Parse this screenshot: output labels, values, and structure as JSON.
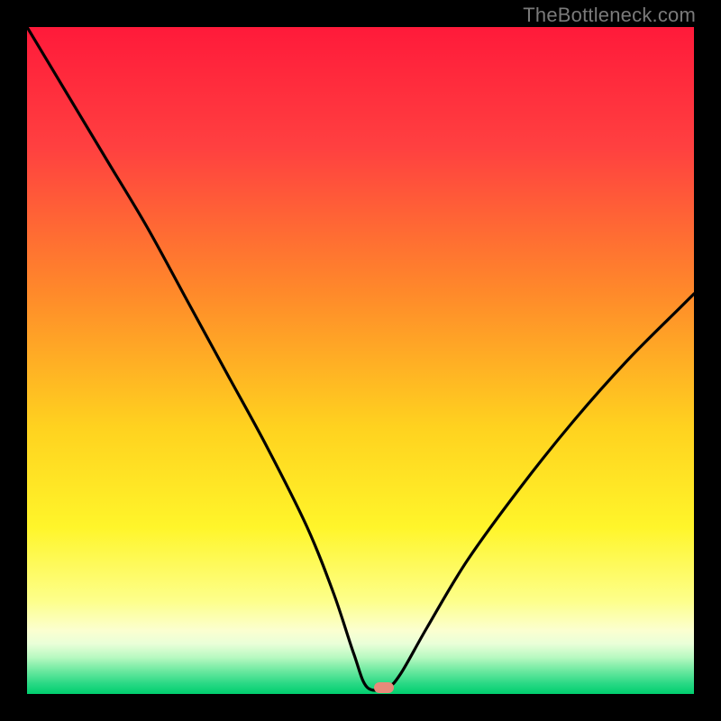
{
  "watermark": "TheBottleneck.com",
  "marker": {
    "color": "#e88a7a",
    "x_pct": 53.5,
    "y_pct": 99.0
  },
  "gradient_stops": [
    {
      "pct": 0,
      "color": "#ff1a3a"
    },
    {
      "pct": 18,
      "color": "#ff4040"
    },
    {
      "pct": 40,
      "color": "#ff8a2a"
    },
    {
      "pct": 60,
      "color": "#ffd21f"
    },
    {
      "pct": 75,
      "color": "#fff52a"
    },
    {
      "pct": 86,
      "color": "#fdff8a"
    },
    {
      "pct": 90.5,
      "color": "#fbffd0"
    },
    {
      "pct": 92.5,
      "color": "#e9ffd8"
    },
    {
      "pct": 94.5,
      "color": "#b8f9c1"
    },
    {
      "pct": 96.5,
      "color": "#6de9a0"
    },
    {
      "pct": 98.5,
      "color": "#28d884"
    },
    {
      "pct": 100,
      "color": "#00cf6e"
    }
  ],
  "chart_data": {
    "type": "line",
    "title": "",
    "xlabel": "",
    "ylabel": "",
    "xlim": [
      0,
      100
    ],
    "ylim": [
      0,
      100
    ],
    "series": [
      {
        "name": "bottleneck-curve",
        "x": [
          0,
          6,
          12,
          18,
          24,
          30,
          36,
          42,
          46,
          49,
          51,
          54,
          56,
          60,
          66,
          74,
          82,
          90,
          98,
          100
        ],
        "y": [
          100,
          90,
          80,
          70,
          59,
          48,
          37,
          25,
          15,
          6,
          1,
          1,
          3,
          10,
          20,
          31,
          41,
          50,
          58,
          60
        ]
      }
    ],
    "annotations": [
      {
        "type": "marker",
        "x": 53.5,
        "y": 1,
        "shape": "pill",
        "color": "#e88a7a"
      }
    ]
  }
}
